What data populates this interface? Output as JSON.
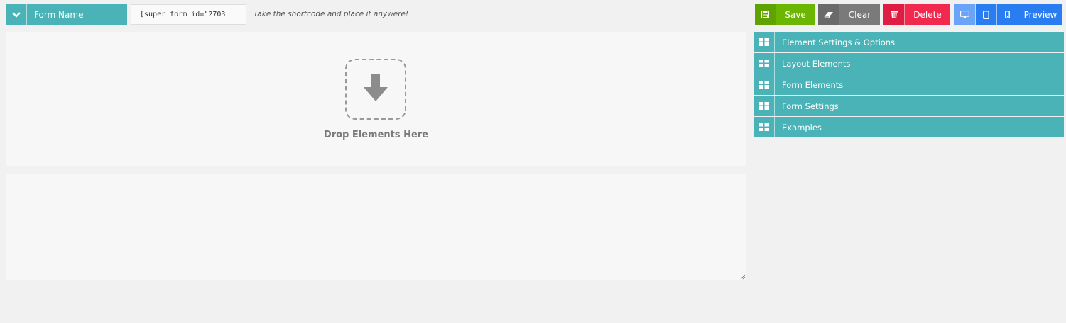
{
  "header": {
    "form_name": "Form Name",
    "shortcode": "[super_form id=\"2703",
    "hint": "Take the shortcode and place it anywere!"
  },
  "toolbar": {
    "save_label": "Save",
    "clear_label": "Clear",
    "delete_label": "Delete",
    "preview_label": "Preview",
    "save_color": "#6bb600",
    "clear_color": "#7a7a7a",
    "delete_color": "#f2294e",
    "preview_color": "#2a7df1",
    "active_device": "desktop"
  },
  "canvas": {
    "drop_text": "Drop Elements Here"
  },
  "panels": [
    {
      "label": "Element Settings & Options"
    },
    {
      "label": "Layout Elements"
    },
    {
      "label": "Form Elements"
    },
    {
      "label": "Form Settings"
    },
    {
      "label": "Examples"
    }
  ],
  "accent_color": "#4ab3b7"
}
